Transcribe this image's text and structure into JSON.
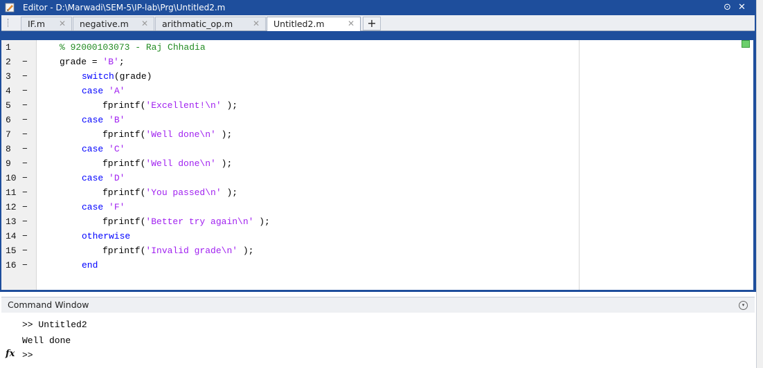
{
  "window": {
    "title": "Editor - D:\\Marwadi\\SEM-5\\IP-lab\\Prg\\Untitled2.m",
    "menu_glyph": "⊙",
    "close_glyph": "✕"
  },
  "tabs": [
    {
      "label": "IF.m",
      "close": "✕",
      "active": false
    },
    {
      "label": "negative.m",
      "close": "✕",
      "active": false
    },
    {
      "label": "arithmatic_op.m",
      "close": "✕",
      "active": false
    },
    {
      "label": "Untitled2.m",
      "close": "✕",
      "active": true
    }
  ],
  "add_tab_label": "+",
  "code": {
    "lines": [
      {
        "n": "1",
        "dash": "",
        "indent": 0,
        "parts": [
          {
            "t": "% 92000103073 - Raj Chhadia",
            "c": "com"
          }
        ]
      },
      {
        "n": "2",
        "dash": "−",
        "indent": 0,
        "parts": [
          {
            "t": "grade = ",
            "c": "plain"
          },
          {
            "t": "'B'",
            "c": "str"
          },
          {
            "t": ";",
            "c": "plain"
          }
        ]
      },
      {
        "n": "3",
        "dash": "−",
        "indent": 1,
        "parts": [
          {
            "t": "switch",
            "c": "kw"
          },
          {
            "t": "(grade)",
            "c": "plain"
          }
        ]
      },
      {
        "n": "4",
        "dash": "−",
        "indent": 1,
        "parts": [
          {
            "t": "case ",
            "c": "kw"
          },
          {
            "t": "'A'",
            "c": "str"
          }
        ]
      },
      {
        "n": "5",
        "dash": "−",
        "indent": 2,
        "parts": [
          {
            "t": "fprintf(",
            "c": "plain"
          },
          {
            "t": "'Excellent!\\n'",
            "c": "str"
          },
          {
            "t": " );",
            "c": "plain"
          }
        ]
      },
      {
        "n": "6",
        "dash": "−",
        "indent": 1,
        "parts": [
          {
            "t": "case ",
            "c": "kw"
          },
          {
            "t": "'B'",
            "c": "str"
          }
        ]
      },
      {
        "n": "7",
        "dash": "−",
        "indent": 2,
        "parts": [
          {
            "t": "fprintf(",
            "c": "plain"
          },
          {
            "t": "'Well done\\n'",
            "c": "str"
          },
          {
            "t": " );",
            "c": "plain"
          }
        ]
      },
      {
        "n": "8",
        "dash": "−",
        "indent": 1,
        "parts": [
          {
            "t": "case ",
            "c": "kw"
          },
          {
            "t": "'C'",
            "c": "str"
          }
        ]
      },
      {
        "n": "9",
        "dash": "−",
        "indent": 2,
        "parts": [
          {
            "t": "fprintf(",
            "c": "plain"
          },
          {
            "t": "'Well done\\n'",
            "c": "str"
          },
          {
            "t": " );",
            "c": "plain"
          }
        ]
      },
      {
        "n": "10",
        "dash": "−",
        "indent": 1,
        "parts": [
          {
            "t": "case ",
            "c": "kw"
          },
          {
            "t": "'D'",
            "c": "str"
          }
        ]
      },
      {
        "n": "11",
        "dash": "−",
        "indent": 2,
        "parts": [
          {
            "t": "fprintf(",
            "c": "plain"
          },
          {
            "t": "'You passed\\n'",
            "c": "str"
          },
          {
            "t": " );",
            "c": "plain"
          }
        ]
      },
      {
        "n": "12",
        "dash": "−",
        "indent": 1,
        "parts": [
          {
            "t": "case ",
            "c": "kw"
          },
          {
            "t": "'F'",
            "c": "str"
          }
        ]
      },
      {
        "n": "13",
        "dash": "−",
        "indent": 2,
        "parts": [
          {
            "t": "fprintf(",
            "c": "plain"
          },
          {
            "t": "'Better try again\\n'",
            "c": "str"
          },
          {
            "t": " );",
            "c": "plain"
          }
        ]
      },
      {
        "n": "14",
        "dash": "−",
        "indent": 1,
        "parts": [
          {
            "t": "otherwise",
            "c": "kw"
          }
        ]
      },
      {
        "n": "15",
        "dash": "−",
        "indent": 2,
        "parts": [
          {
            "t": "fprintf(",
            "c": "plain"
          },
          {
            "t": "'Invalid grade\\n'",
            "c": "str"
          },
          {
            "t": " );",
            "c": "plain"
          }
        ]
      },
      {
        "n": "16",
        "dash": "−",
        "indent": 1,
        "parts": [
          {
            "t": "end",
            "c": "kw"
          }
        ]
      }
    ]
  },
  "command_window": {
    "title": "Command Window",
    "menu_glyph": "▾",
    "lines": [
      ">> Untitled2",
      "Well done"
    ],
    "prompt": ">>",
    "fx_label": "fx"
  },
  "colors": {
    "frame": "#1e4e9c",
    "keyword": "#0000ff",
    "string": "#a020f0",
    "comment": "#228b22",
    "status_ok": "#6ccf6c"
  }
}
